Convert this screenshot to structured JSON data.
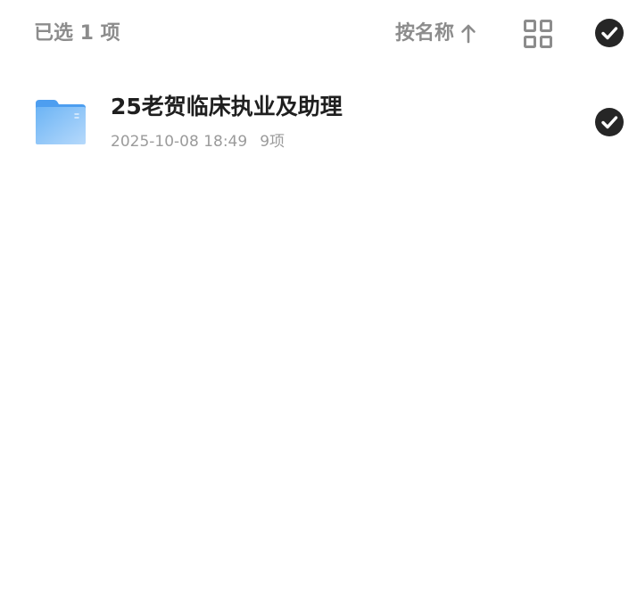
{
  "header": {
    "selected_count_text": "已选 1 项",
    "sort_label": "按名称",
    "sort_direction": "ascending",
    "sort_arrow_icon": "arrow-up-icon",
    "view_toggle_icon": "grid-view-icon",
    "select_all_icon": "check-circle-icon",
    "select_all_checked": true
  },
  "files": [
    {
      "name": "25老贺临床执业及助理",
      "type": "folder",
      "icon": "folder-icon",
      "modified": "2025-10-08 18:49",
      "item_count": "9项",
      "selected": true
    }
  ],
  "colors": {
    "muted_text": "#8c8c8c",
    "primary_text": "#1f1f1f",
    "check_fill": "#262626",
    "folder_blue": "#5aa9f2",
    "folder_light": "#a9d1fb"
  }
}
